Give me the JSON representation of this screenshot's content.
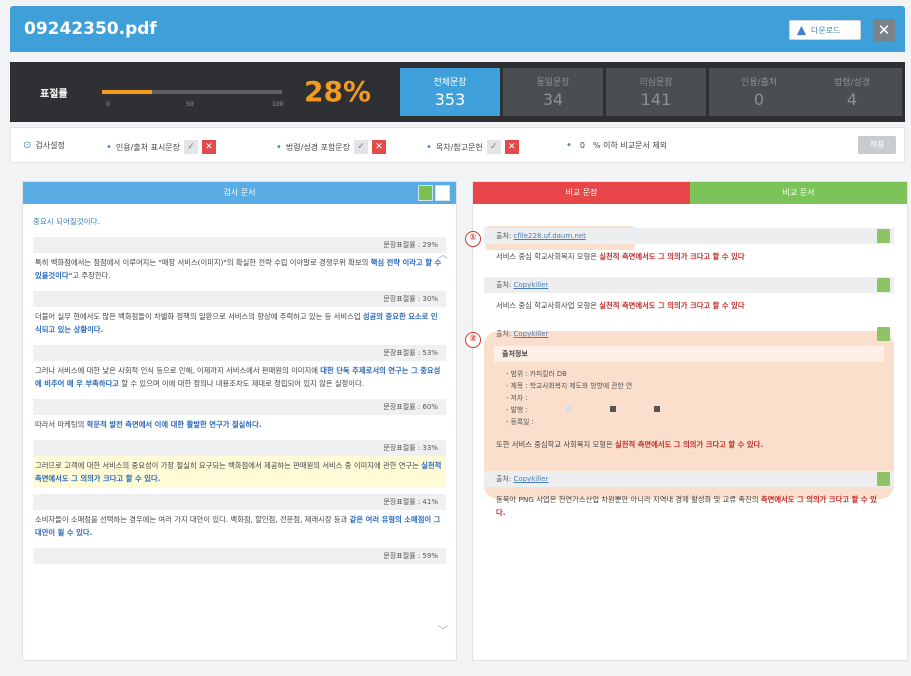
{
  "window": {
    "title": "09242350.pdf",
    "download_label": "다운로드",
    "close_label": "✕"
  },
  "stats": {
    "similarity_label": "표절률",
    "similarity_value": "28%",
    "similarity_fraction": 0.28,
    "ticks": [
      "0",
      "50",
      "100"
    ],
    "boxes": [
      {
        "label": "전체문장",
        "value": "353"
      },
      {
        "label": "동일문장",
        "value": "34"
      },
      {
        "label": "의심문장",
        "value": "141"
      },
      {
        "label": "인용/출처",
        "value": "0"
      },
      {
        "label": "법령/성경",
        "value": "4"
      }
    ]
  },
  "options": {
    "settings_label": "검사설정",
    "quote_label": "인용/출처 표시문장",
    "law_label": "법령/성경 포함문장",
    "toc_label": "목차/참고문헌",
    "threshold_value": "0",
    "threshold_label": "% 이하 비교문서 제외",
    "apply_label": "적용"
  },
  "left": {
    "header": "검사 문서",
    "intro": "중요시 되어질것이다.",
    "segments": [
      {
        "score": "문장표절률 : 29%",
        "text": "특히 백화점에서는 점점에서 이루어지는 \"매장 서비스(이미지)\"의 확실한 전략 수립 이야말로 경쟁우위 확보의 ",
        "hl": "핵심 전략 이라고 할 수 있을것이다\"",
        "tail": "고 주장한다.",
        "yellow": false
      },
      {
        "score": "문장표절률 : 30%",
        "text": "더불어 실무 현에서도 많은 백화점들이 차별화 정책의 일환으로 서비스의 향상에 주력하고 있는 등 서비스업 ",
        "hl": "성공의 중요한 요소로 인식되고 있는 상황이다.",
        "tail": "",
        "yellow": false
      },
      {
        "score": "문장표절률 : 53%",
        "text": "그러나 서비스에 대한 낮은 사회적 인식 등으로 인해, 이제까지 서비스에서 판매원의 이미지에 ",
        "hl": "대한 단독 주제로서의 연구는 그 중요성에 비추어 매 우 부족하다고",
        "tail": " 할 수 있으며 이에 대한 정의나 내용조차도 제대로 정립되어 있지 않은 실정이다.",
        "yellow": false
      },
      {
        "score": "문장표절률 : 60%",
        "text": "따라서 마케팅의 ",
        "hl": "학문적 발전 측면에서 이에 대한 활발한 연구가 절실하다.",
        "tail": "",
        "yellow": false
      },
      {
        "score": "문장표절률 : 33%",
        "text": "그러므로 고객에 대한 서비스의 중요성이 가장 절실히 요구되는 백화점에서 제공하는 판매원의 서비스 중 이미지에 관한 연구는 ",
        "hl": "실천적 측면에서도 그 의의가 크다고 할 수 있다.",
        "tail": "",
        "yellow": true
      },
      {
        "score": "문장표절률 : 41%",
        "text": "소비자들이 소매점을 선택하는 경우에는 여러 가지 대안이 있다. 백화점, 할인점, 전문점, 재래시장 등과 ",
        "hl": "같은 여러 유형의 소매점이 그 대안이 될 수 있다.",
        "tail": "",
        "yellow": false
      }
    ],
    "last_score": "문장표절률 : 59%"
  },
  "right": {
    "tab_compare_sentence": "비교 문장",
    "tab_compare_doc": "비교 문서",
    "sources": [
      {
        "label": "출처:",
        "name": "cfile228.uf.daum.net",
        "text": "서비스 중심 학교사회복지 모형은 ",
        "red": "실천적 측면에서도 그 의의가 크다고 할 수 있다"
      },
      {
        "label": "출처:",
        "name": "Copykiller",
        "text": "서비스 중심 학교사회사업 모형은 ",
        "red": "실천적 측면에서도 그 의의가 크다고 할 수 있다"
      },
      {
        "label": "출처:",
        "name": "Copykiller",
        "text": "또한 서비스 중심학교 사회복지 모형은 ",
        "red": "실천적 측면에서도 그 의의가 크다고 할 수 있다."
      },
      {
        "label": "출처:",
        "name": "Copykiller",
        "text": "동북아 PNG 사업은 천연가스산업 차원뿐만 아니라 지역내 경제 활성화 및 교류 촉진의 ",
        "red": "측면에서도 그 의의가 크다고 할 수 있다."
      }
    ],
    "info_title": "출처정보",
    "info_lines": [
      "- 범위 : 카피킬러 DB",
      "- 제목 : 학교사회복지 제도화 방향에 관한 연",
      "- 저자 :",
      "- 발행 :",
      "- 등록일 :"
    ],
    "badge1": "①",
    "badge2": "②"
  }
}
